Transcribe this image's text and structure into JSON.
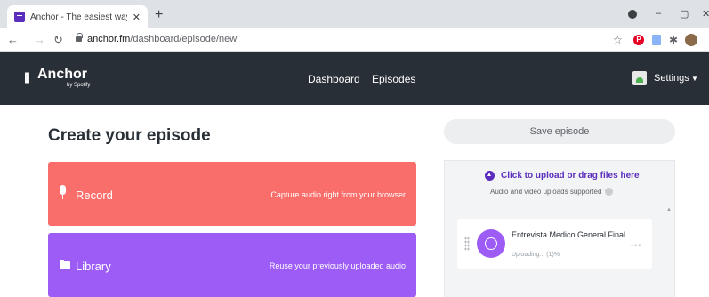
{
  "browser": {
    "tab_title": "Anchor - The easiest way to mak",
    "tab_close": "✕",
    "new_tab": "+",
    "url_host": "anchor.fm",
    "url_path": "/dashboard/episode/new",
    "win_minimize": "–",
    "win_maximize": "▢",
    "win_close": "✕"
  },
  "header": {
    "logo_name": "Anchor",
    "logo_by": "by Spotify",
    "nav": [
      {
        "label": "Dashboard"
      },
      {
        "label": "Episodes"
      }
    ],
    "settings_label": "Settings"
  },
  "main": {
    "page_title": "Create your episode",
    "save_label": "Save episode",
    "record": {
      "label": "Record",
      "description": "Capture audio right from your browser"
    },
    "library": {
      "label": "Library",
      "description": "Reuse your previously uploaded audio"
    }
  },
  "upload": {
    "link_text": "Click to upload or drag files here",
    "support_text": "Audio and video uploads supported",
    "episode_title": "Entrevista Medico General Final",
    "episode_status": "Uploading... (1)%",
    "more": "•••"
  },
  "colors": {
    "header_bg": "#292f36",
    "record": "#f96e6b",
    "library": "#9c5cf5",
    "accent": "#5a2dbd"
  }
}
